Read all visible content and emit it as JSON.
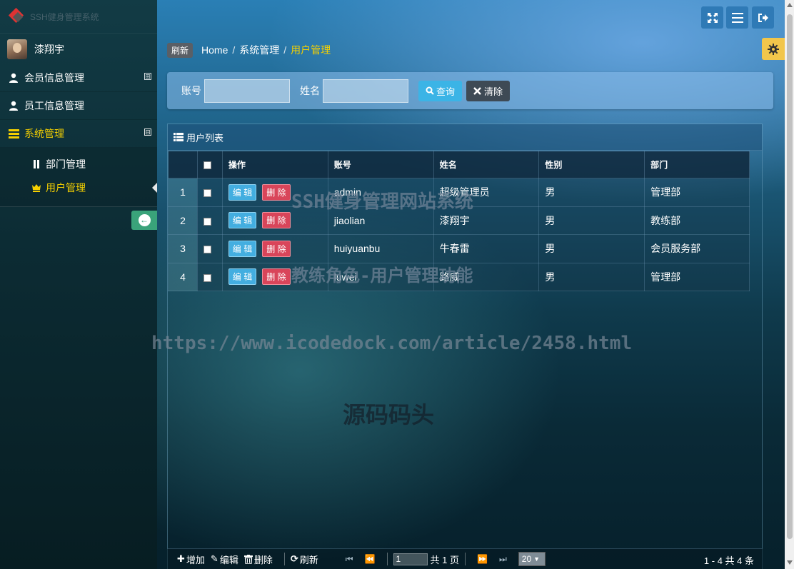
{
  "app": {
    "logo_text": "SSH健身管理系统"
  },
  "user": {
    "name": "漆翔宇"
  },
  "sidebar": {
    "menus": [
      {
        "label": "会员信息管理",
        "icon": "user-icon",
        "expand": "⊞"
      },
      {
        "label": "员工信息管理",
        "icon": "user-icon"
      },
      {
        "label": "系统管理",
        "icon": "list-icon",
        "expand": "⊟",
        "active": true
      }
    ],
    "submenu": [
      {
        "label": "部门管理",
        "icon": "pause-icon"
      },
      {
        "label": "用户管理",
        "icon": "crown-icon",
        "active": true
      }
    ]
  },
  "topbar": {
    "icons": [
      "fullscreen-icon",
      "menu-icon",
      "logout-icon",
      "gear-icon"
    ]
  },
  "breadcrumb": {
    "refresh": "刷新",
    "items": [
      "Home",
      "系统管理",
      "用户管理"
    ]
  },
  "search": {
    "account_label": "账号",
    "name_label": "姓名",
    "account_value": "",
    "name_value": "",
    "query_label": "查询",
    "clear_label": "清除"
  },
  "list": {
    "title": "用户列表",
    "columns": [
      "操作",
      "账号",
      "姓名",
      "性别",
      "部门"
    ],
    "edit_label": "编 辑",
    "delete_label": "删 除",
    "rows": [
      {
        "num": "1",
        "account": "admin",
        "name": "超级管理员",
        "gender": "男",
        "dept": "管理部"
      },
      {
        "num": "2",
        "account": "jiaolian",
        "name": "漆翔宇",
        "gender": "男",
        "dept": "教练部"
      },
      {
        "num": "3",
        "account": "huiyuanbu",
        "name": "牛春雷",
        "gender": "男",
        "dept": "会员服务部"
      },
      {
        "num": "4",
        "account": "luwei",
        "name": "路威",
        "gender": "男",
        "dept": "管理部"
      }
    ]
  },
  "toolbar": {
    "add": "增加",
    "edit": "编辑",
    "delete": "删除",
    "refresh": "刷新",
    "page_value": "1",
    "page_total": "共 1 页",
    "page_size": "20",
    "range": "1 - 4    共 4 条"
  },
  "watermarks": {
    "line1": "SSH健身管理网站系统",
    "line2": "教练角色-用户管理功能",
    "line3": "https://www.icodedock.com/article/2458.html",
    "line4": "源码码头"
  },
  "colors": {
    "accent": "#f5d000",
    "query": "#3bb4e6",
    "delete": "#d9455a",
    "edit": "#43aee0",
    "collapse": "#3aa37a"
  }
}
